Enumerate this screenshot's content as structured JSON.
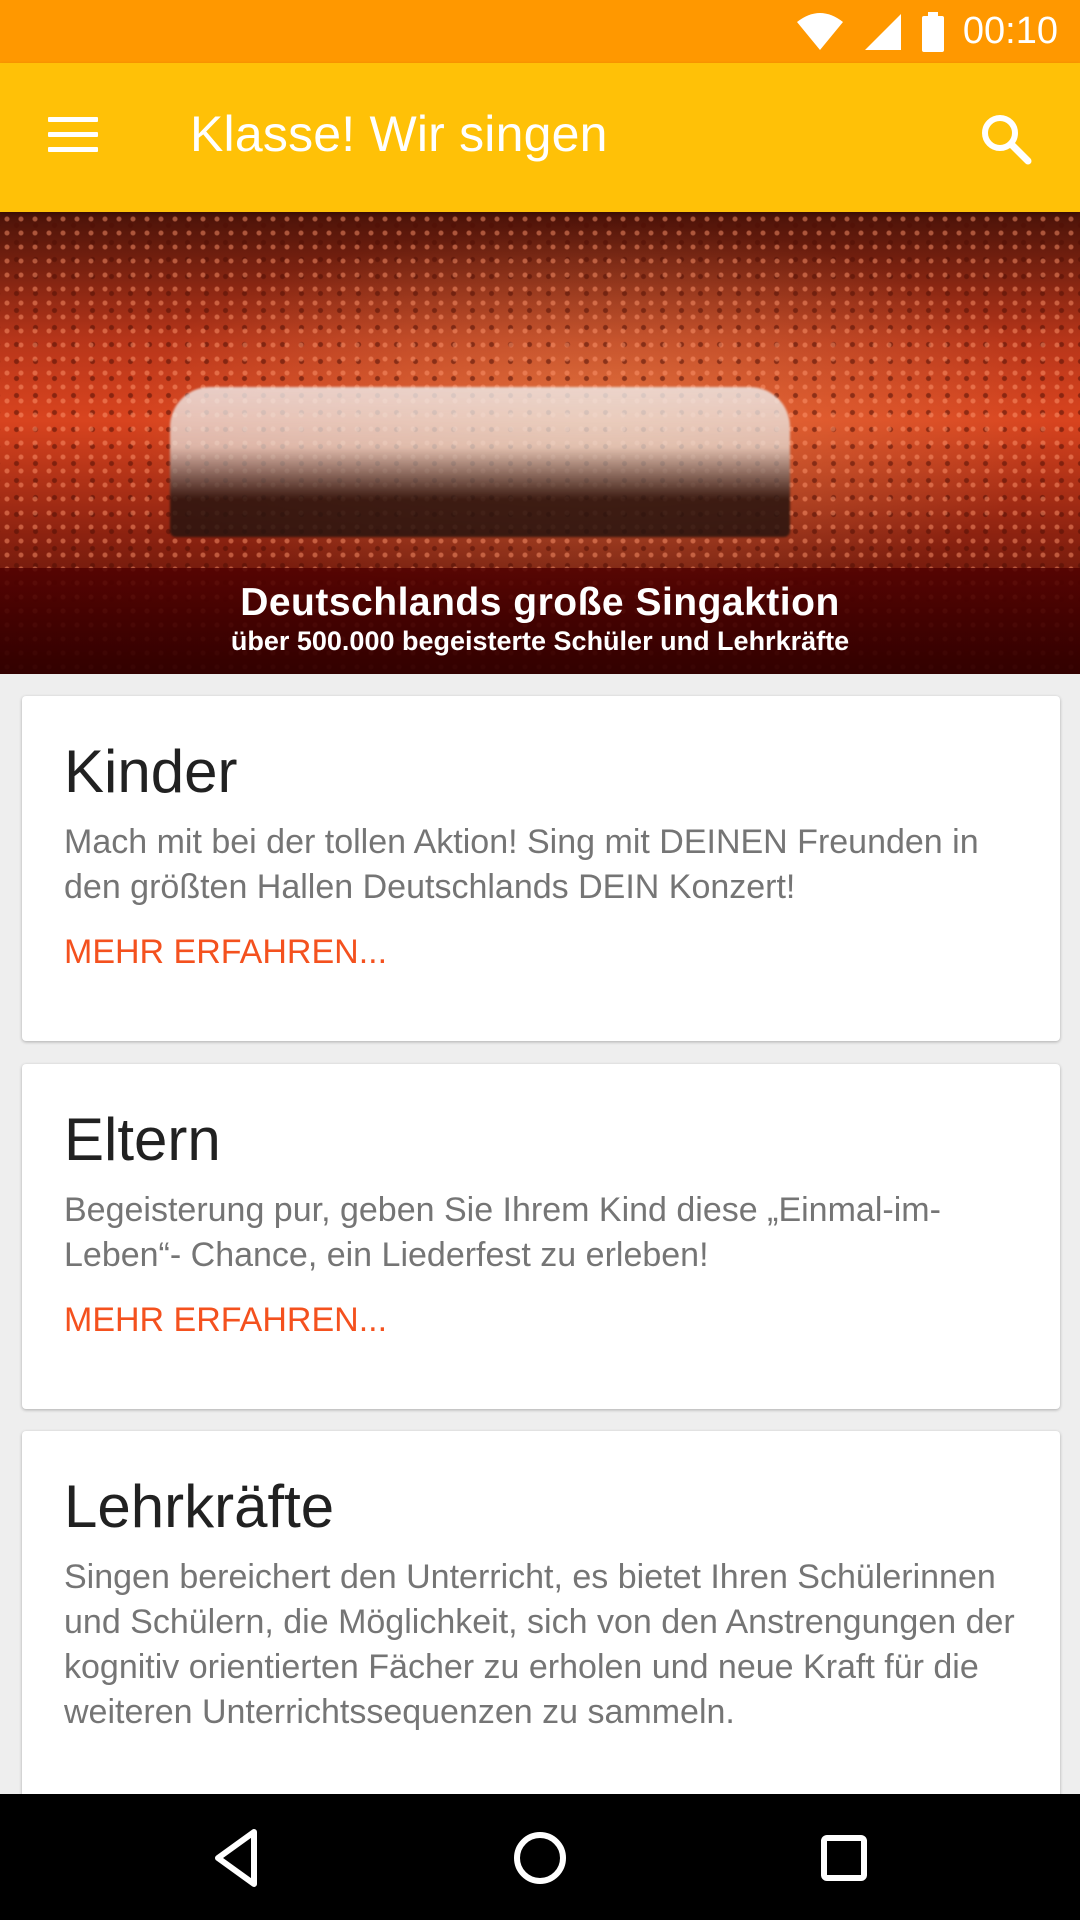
{
  "status_bar": {
    "time": "00:10",
    "icons": [
      "wifi-icon",
      "cell-signal-icon",
      "battery-icon"
    ],
    "background": "#ff9800"
  },
  "app_bar": {
    "title": "Klasse! Wir singen",
    "menu_icon": "menu-icon",
    "search_icon": "search-icon",
    "background": "#ffc107"
  },
  "hero": {
    "title": "Deutschlands große Singaktion",
    "subtitle": "über 500.000 begeisterte Schüler und Lehrkräfte"
  },
  "cards": [
    {
      "title": "Kinder",
      "body": "Mach mit bei der tollen Aktion! Sing mit DEINEN Freunden in den größten Hallen Deutschlands DEIN Konzert!",
      "link": "MEHR ERFAHREN..."
    },
    {
      "title": "Eltern",
      "body": "Begeisterung pur, geben Sie Ihrem Kind diese „Einmal-im-Leben“- Chance, ein Liederfest zu erleben!",
      "link": "MEHR ERFAHREN..."
    },
    {
      "title": "Lehrkräfte",
      "body": "Singen bereichert den Unterricht, es bietet Ihren Schülerinnen und Schülern, die Möglichkeit, sich von den Anstrengungen der kognitiv orientierten Fächer zu erholen und neue Kraft für die weiteren Unterrichtssequenzen zu sammeln."
    }
  ],
  "nav_bar": {
    "buttons": [
      "back-icon",
      "home-icon",
      "recents-icon"
    ]
  },
  "colors": {
    "accent_link": "#f4511e",
    "title_text": "#212121",
    "body_text": "#757575"
  }
}
